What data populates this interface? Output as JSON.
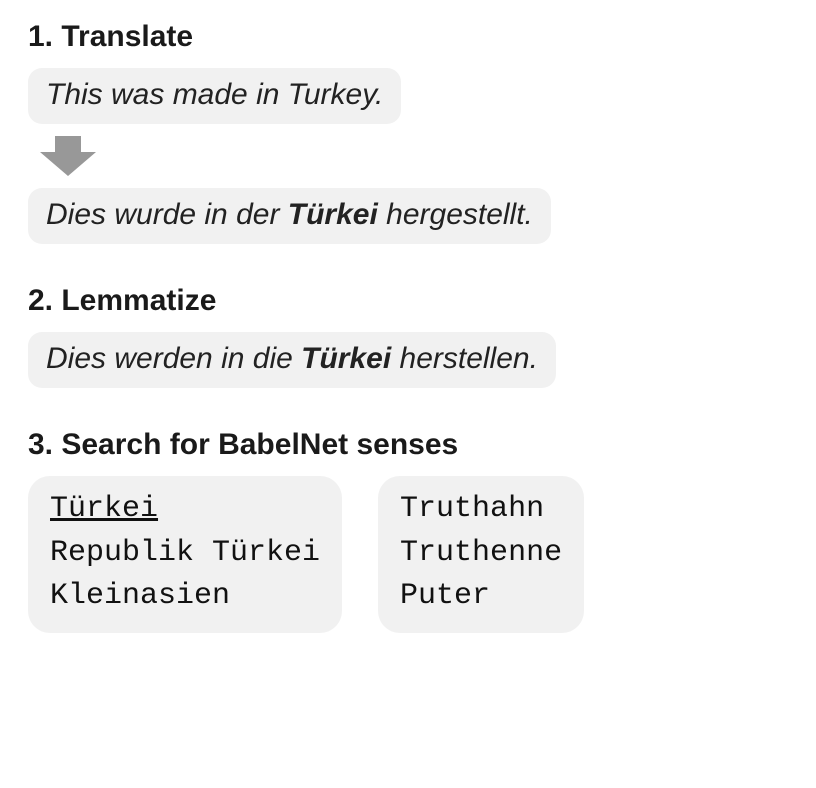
{
  "sections": {
    "translate": {
      "heading": "1. Translate",
      "source_sentence": "This was made in Turkey.",
      "target_sentence_parts": {
        "prefix": "Dies wurde in der ",
        "emph": "Türkei",
        "suffix": " hergestellt."
      }
    },
    "lemmatize": {
      "heading": "2. Lemmatize",
      "sentence_parts": {
        "prefix": "Dies werden in die ",
        "emph": "Türkei",
        "suffix": " herstellen."
      }
    },
    "senses": {
      "heading": "3. Search for BabelNet senses",
      "group_a": {
        "items": [
          {
            "label": "Türkei",
            "selected": true
          },
          {
            "label": "Republik Türkei",
            "selected": false
          },
          {
            "label": "Kleinasien",
            "selected": false
          }
        ]
      },
      "group_b": {
        "items": [
          {
            "label": "Truthahn",
            "selected": false
          },
          {
            "label": "Truthenne",
            "selected": false
          },
          {
            "label": "Puter",
            "selected": false
          }
        ]
      }
    }
  },
  "colors": {
    "box_bg": "#f1f1f1",
    "arrow": "#989898",
    "text": "#1a1a1a"
  }
}
